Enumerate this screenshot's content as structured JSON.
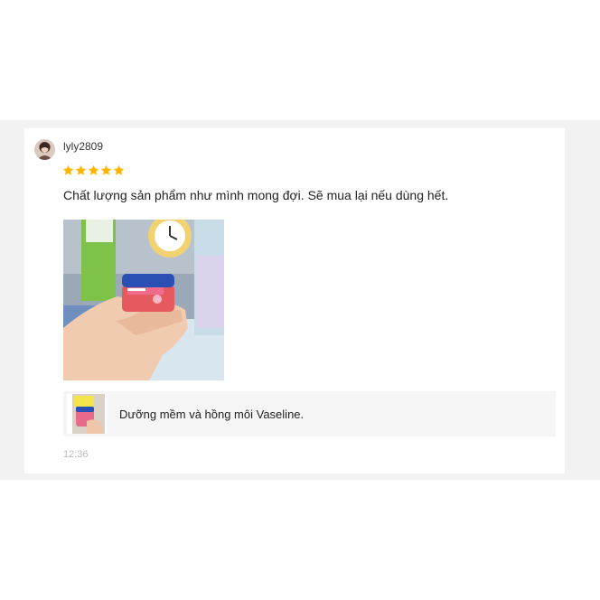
{
  "review": {
    "username": "lyly2809",
    "rating": 5,
    "rating_max": 5,
    "comment": "Chất lượng sản phẩm như mình mong đợi. Sẽ mua lại nếu dùng hết.",
    "timestamp": "12:36"
  },
  "product": {
    "name": "Dưỡng mềm và hồng môi Vaseline."
  },
  "colors": {
    "star": "#ffb400",
    "backdrop": "#f2f2f2",
    "product_bar": "#f5f5f5"
  },
  "icons": {
    "star": "star-icon"
  }
}
